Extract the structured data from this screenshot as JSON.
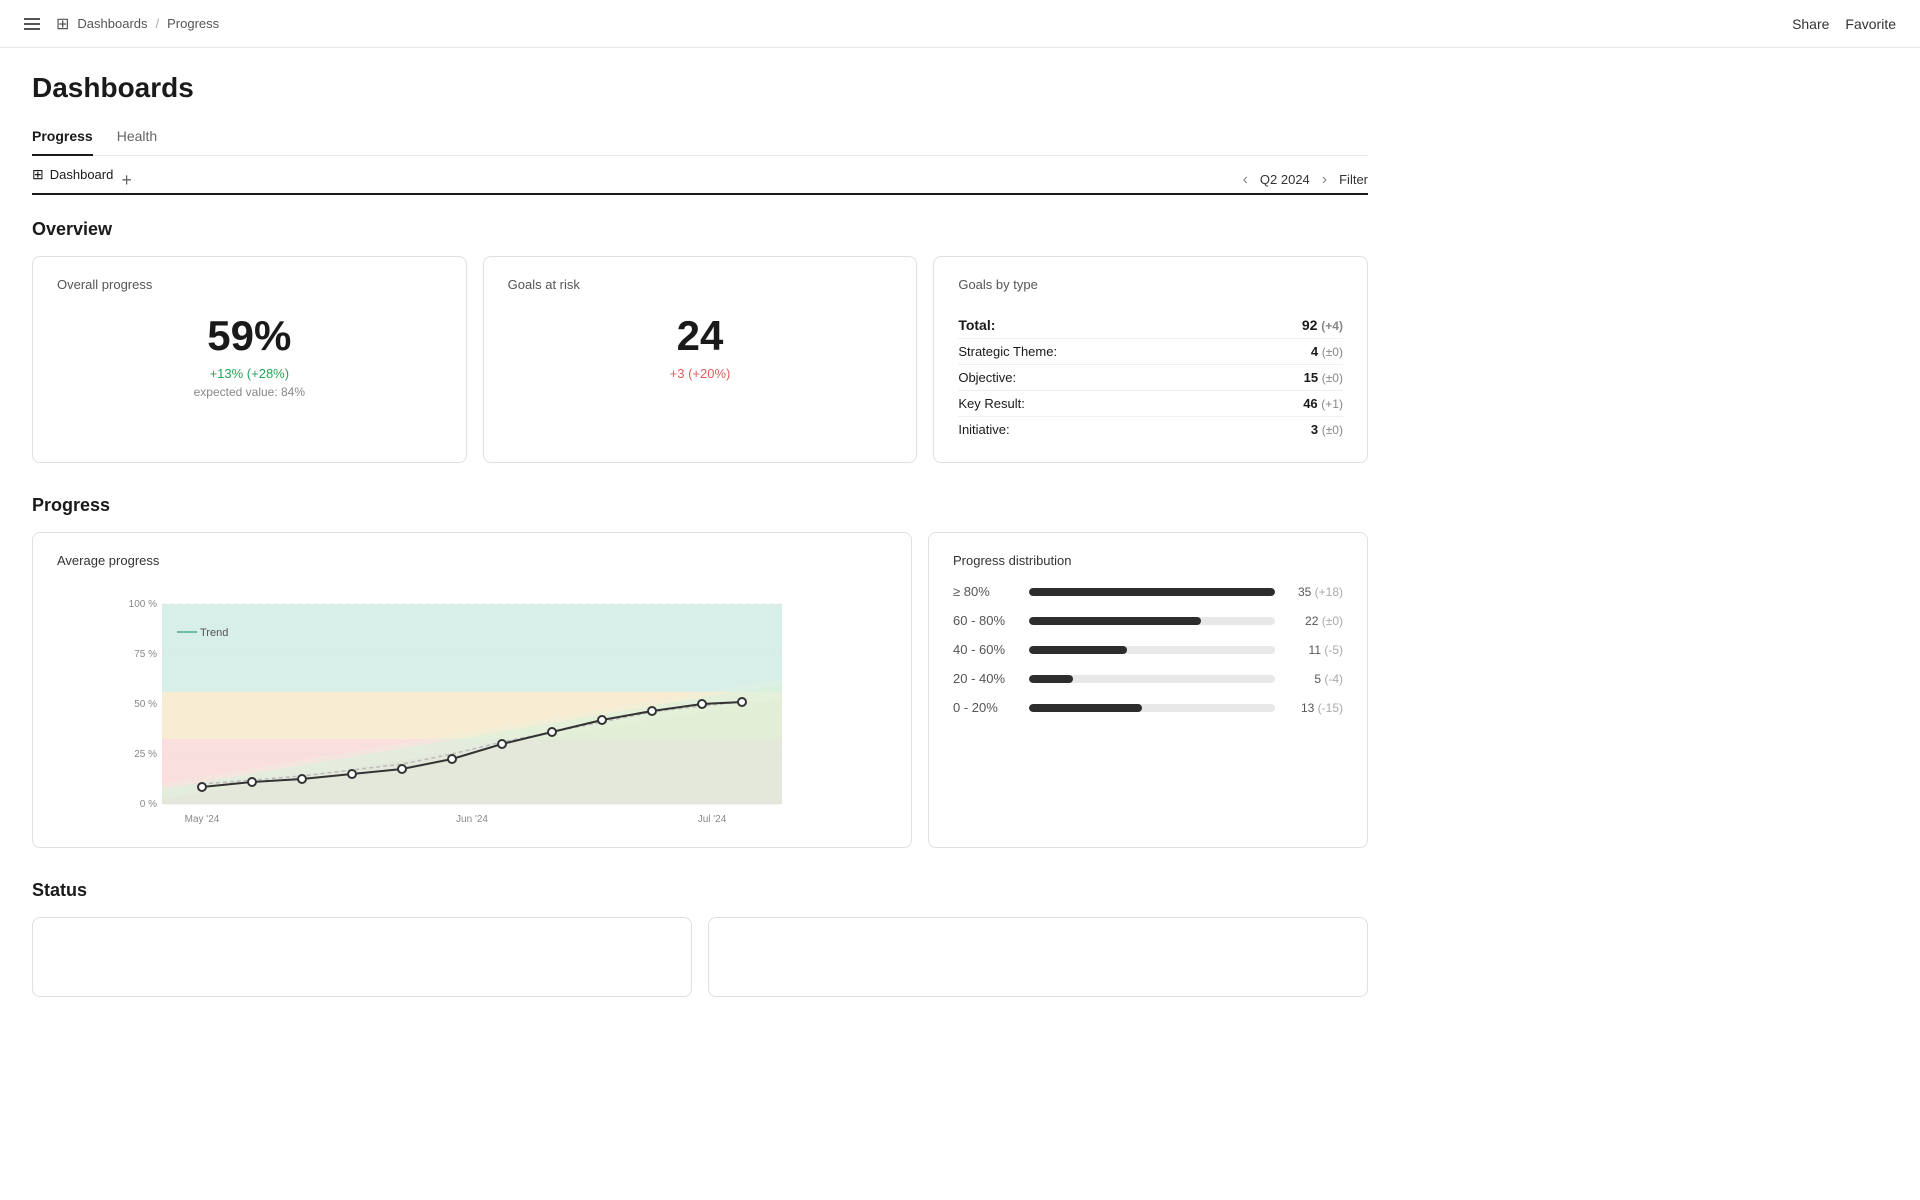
{
  "topnav": {
    "dashboards_label": "Dashboards",
    "sep": "/",
    "progress_label": "Progress",
    "share_label": "Share",
    "favorite_label": "Favorite"
  },
  "page": {
    "title": "Dashboards"
  },
  "tabs": [
    {
      "id": "progress",
      "label": "Progress",
      "active": true
    },
    {
      "id": "health",
      "label": "Health",
      "active": false
    }
  ],
  "sub_toolbar": {
    "dashboard_label": "Dashboard",
    "add_label": "+",
    "quarter": "Q2 2024",
    "filter_label": "Filter"
  },
  "overview": {
    "section_title": "Overview",
    "overall_progress": {
      "title": "Overall progress",
      "value": "59%",
      "change": "+13% (+28%)",
      "expected": "expected value: 84%"
    },
    "goals_at_risk": {
      "title": "Goals at risk",
      "value": "24",
      "change": "+3 (+20%)"
    },
    "goals_by_type": {
      "title": "Goals by type",
      "rows": [
        {
          "label": "Total:",
          "value": "92",
          "change": "(+4)",
          "is_total": true
        },
        {
          "label": "Strategic Theme:",
          "value": "4",
          "change": "(±0)",
          "is_total": false
        },
        {
          "label": "Objective:",
          "value": "15",
          "change": "(±0)",
          "is_total": false
        },
        {
          "label": "Key Result:",
          "value": "46",
          "change": "(+1)",
          "is_total": false
        },
        {
          "label": "Initiative:",
          "value": "3",
          "change": "(±0)",
          "is_total": false
        }
      ]
    }
  },
  "progress_section": {
    "section_title": "Progress",
    "chart": {
      "title": "Average progress",
      "trend_label": "Trend",
      "x_labels": [
        "May '24",
        "Jun '24",
        "Jul '24"
      ],
      "y_labels": [
        "100 %",
        "75 %",
        "50 %",
        "25 %",
        "0 %"
      ]
    },
    "distribution": {
      "title": "Progress distribution",
      "rows": [
        {
          "range": "≥ 80%",
          "count": "35",
          "change": "(+18)",
          "bar_pct": 100
        },
        {
          "range": "60 - 80%",
          "count": "22",
          "change": "(±0)",
          "bar_pct": 70
        },
        {
          "range": "40 - 60%",
          "count": "11",
          "change": "(-5)",
          "bar_pct": 40
        },
        {
          "range": "20 - 40%",
          "count": "5",
          "change": "(-4)",
          "bar_pct": 18
        },
        {
          "range": "0 - 20%",
          "count": "13",
          "change": "(-15)",
          "bar_pct": 46
        }
      ]
    }
  },
  "status_section": {
    "section_title": "Status"
  }
}
